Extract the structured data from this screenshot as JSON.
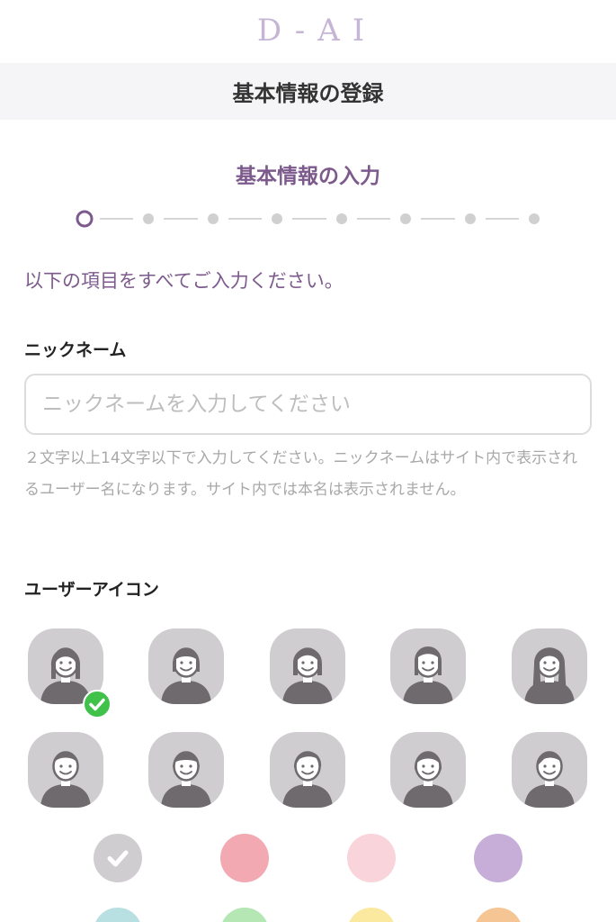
{
  "brand": {
    "logo_text": "D-AI"
  },
  "header": {
    "title": "基本情報の登録"
  },
  "section": {
    "title": "基本情報の入力"
  },
  "stepper": {
    "total_steps": 8,
    "current_step": 1
  },
  "instruction": "以下の項目をすべてご入力ください。",
  "nickname": {
    "label": "ニックネーム",
    "placeholder": "ニックネームを入力してください",
    "value": "",
    "help": "２文字以上14文字以下で入力してください。ニックネームはサイト内で表示されるユーザー名になります。サイト内では本名は表示されません。"
  },
  "user_icon": {
    "label": "ユーザーアイコン",
    "selected_index": 0,
    "avatars": [
      {
        "icon": "woman-medium-hair-icon"
      },
      {
        "icon": "woman-bob-bangs-icon"
      },
      {
        "icon": "woman-bob-icon"
      },
      {
        "icon": "woman-bob-tall-icon"
      },
      {
        "icon": "woman-long-hair-icon"
      },
      {
        "icon": "man-short-hair-icon"
      },
      {
        "icon": "man-bangs-icon"
      },
      {
        "icon": "man-side-part-icon"
      },
      {
        "icon": "woman-short-hair-icon"
      },
      {
        "icon": "man-parted-hair-icon"
      }
    ]
  },
  "background_colors": {
    "selected_index": 0,
    "swatches": [
      "#d0cdd1",
      "#f2a9b1",
      "#f9d4da",
      "#c6aed8",
      "#b8e0e2",
      "#b4e7b4",
      "#fbe9a0",
      "#f5c593"
    ]
  },
  "colors": {
    "accent": "#7d5a8c",
    "check_green": "#3fc14a",
    "avatar_bg": "#d0cdd1",
    "avatar_figure": "#6e6a6e"
  }
}
